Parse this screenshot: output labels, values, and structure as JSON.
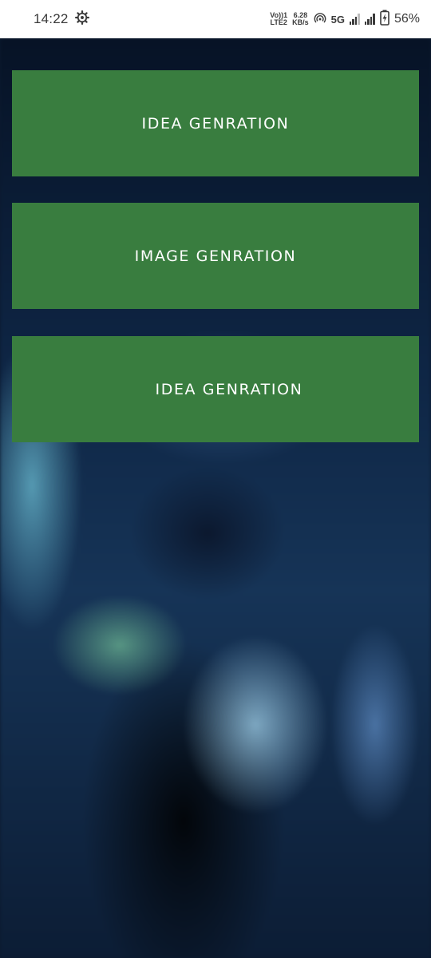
{
  "status_bar": {
    "time": "14:22",
    "settings_icon": "gear-icon",
    "volte_line1": "Vo))1",
    "volte_line2": "LTE2",
    "speed_value": "6.28",
    "speed_unit": "KB/s",
    "hotspot_icon": "hotspot-icon",
    "network_type": "5G",
    "battery_icon": "battery-charging-icon",
    "battery_percent": "56%"
  },
  "buttons": [
    {
      "label": "IDEA GENRATION"
    },
    {
      "label": "IMAGE GENRATION"
    },
    {
      "label": "IDEA GENRATION"
    }
  ],
  "colors": {
    "button_bg": "#397d3f",
    "button_text": "#ffffff",
    "status_bar_bg": "#ffffff"
  }
}
